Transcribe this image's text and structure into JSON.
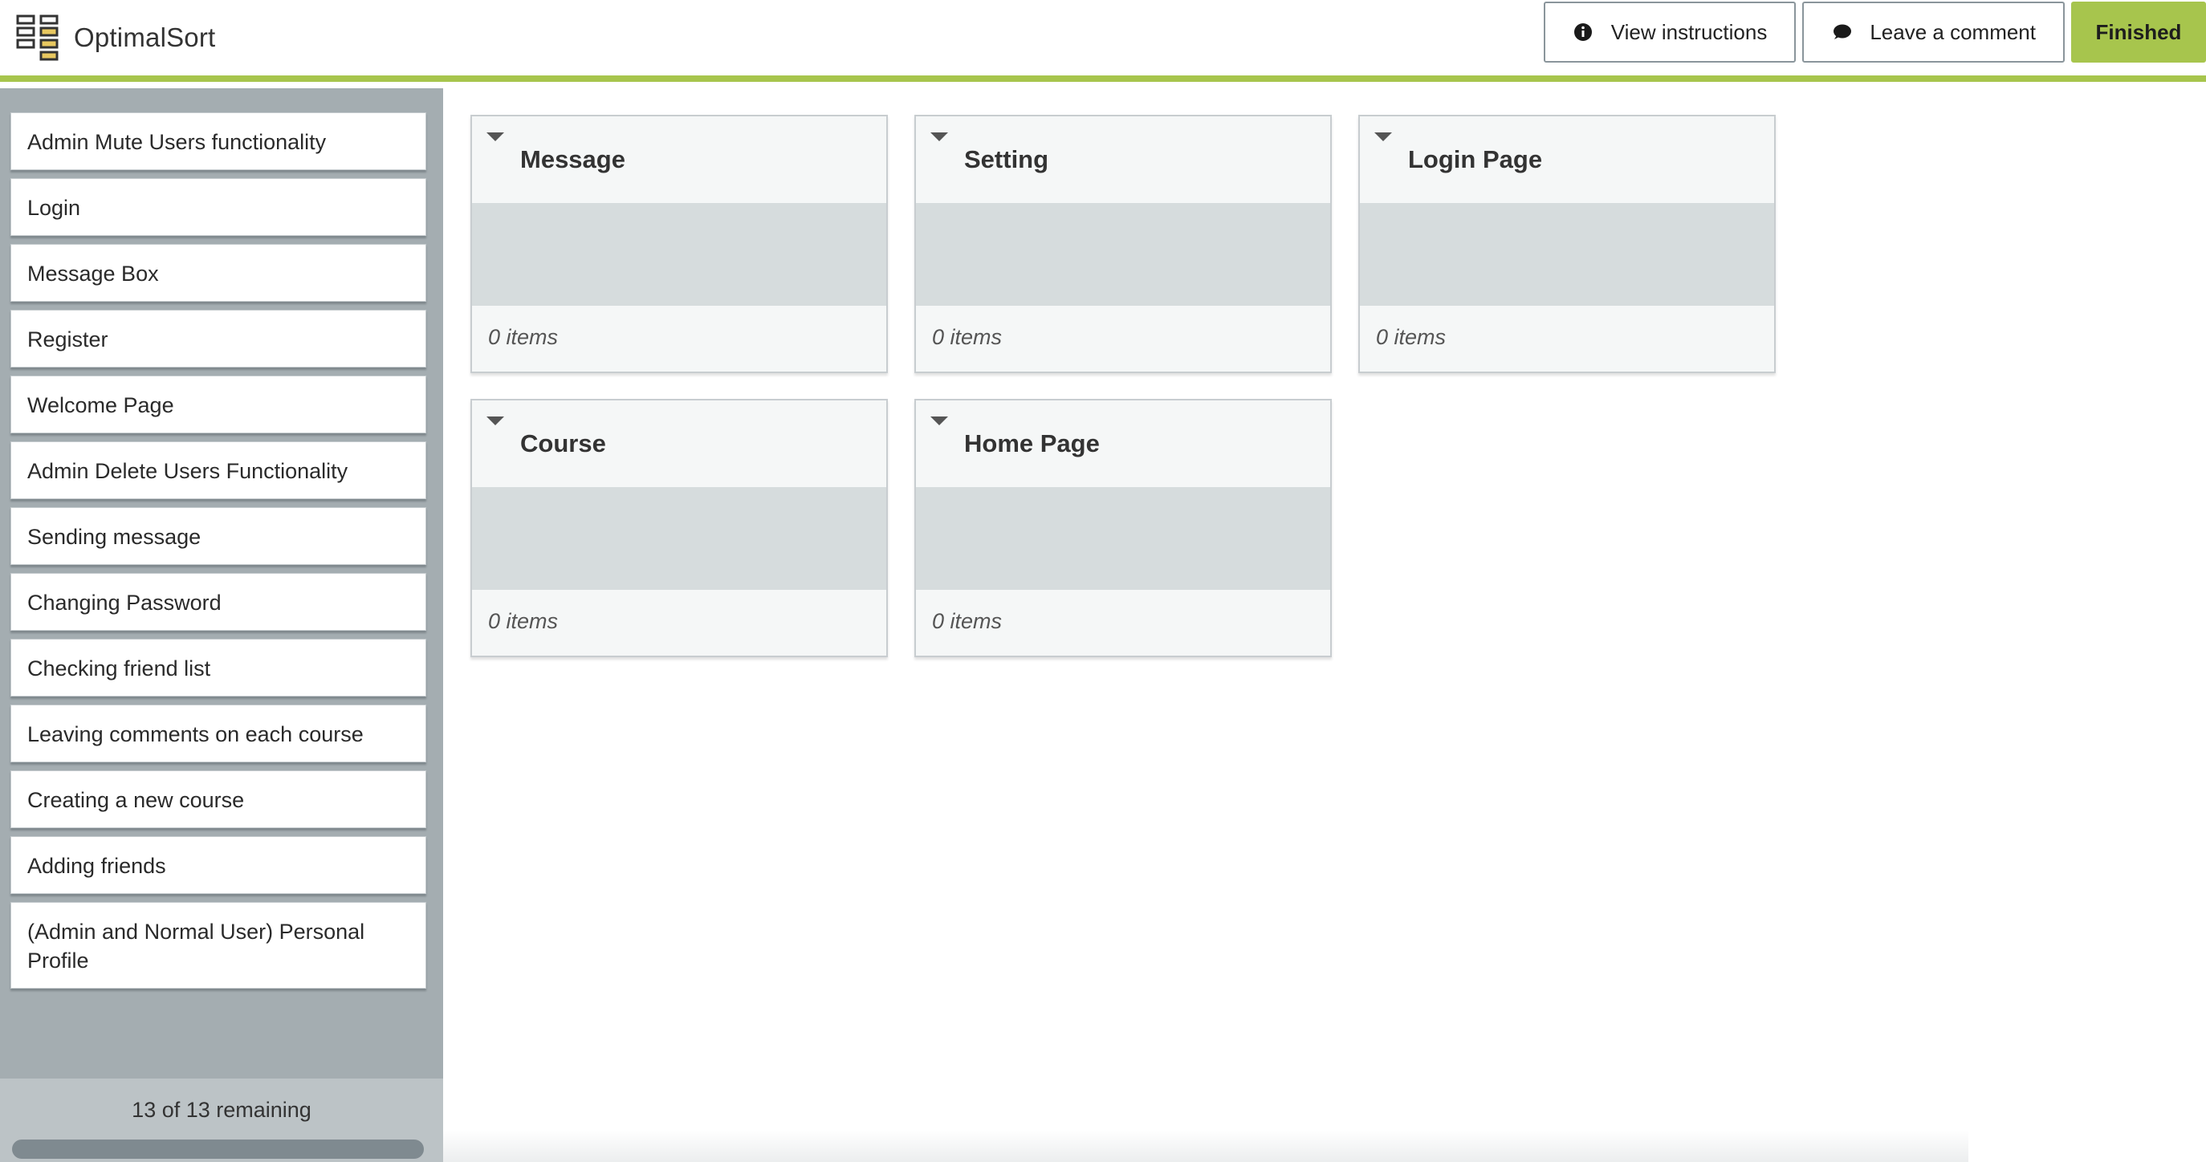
{
  "header": {
    "brand_name": "OptimalSort",
    "view_instructions_label": "View instructions",
    "leave_comment_label": "Leave a comment",
    "finished_label": "Finished",
    "accent_color": "#a7c54d"
  },
  "sidebar": {
    "cards": [
      {
        "label": "Admin Mute Users functionality"
      },
      {
        "label": "Login"
      },
      {
        "label": "Message Box"
      },
      {
        "label": "Register"
      },
      {
        "label": "Welcome Page"
      },
      {
        "label": "Admin Delete Users Functionality"
      },
      {
        "label": "Sending message"
      },
      {
        "label": "Changing Password"
      },
      {
        "label": "Checking friend list"
      },
      {
        "label": "Leaving comments on each course"
      },
      {
        "label": "Creating a new course"
      },
      {
        "label": "Adding friends"
      },
      {
        "label": "(Admin and Normal User) Personal Profile"
      }
    ],
    "remaining_text": "13 of 13 remaining",
    "progress_fraction": 0
  },
  "categories": [
    {
      "title": "Message",
      "count_text": "0 items"
    },
    {
      "title": "Setting",
      "count_text": "0 items"
    },
    {
      "title": "Login Page",
      "count_text": "0 items"
    },
    {
      "title": "Course",
      "count_text": "0 items"
    },
    {
      "title": "Home Page",
      "count_text": "0 items"
    }
  ]
}
